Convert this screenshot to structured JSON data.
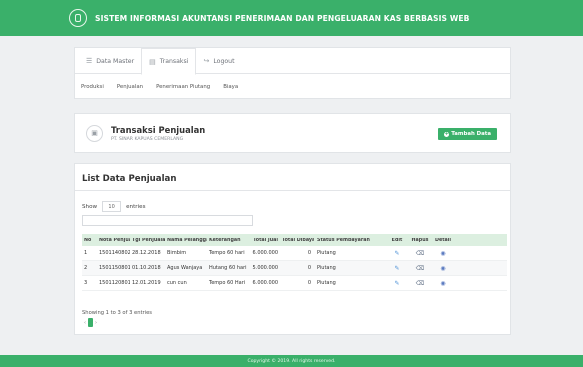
{
  "header": {
    "title": "SISTEM INFORMASI AKUNTANSI PENERIMAAN DAN PENGELUARAN KAS BERBASIS WEB"
  },
  "nav": {
    "tabs": [
      {
        "label": "Data Master",
        "icon": "users-icon"
      },
      {
        "label": "Transaksi",
        "icon": "desktop-icon"
      },
      {
        "label": "Logout",
        "icon": "logout-icon"
      }
    ],
    "subnav": [
      "Produksi",
      "Penjualan",
      "Penerimaan Piutang",
      "Biaya"
    ]
  },
  "page": {
    "title": "Transaksi Penjualan",
    "subtitle": "PT. SINAR KAPUAS CEMERLANG",
    "add_button": "Tambah Data"
  },
  "list": {
    "title": "List Data Penjualan",
    "show_label": "Show",
    "entries_value": "10",
    "entries_label": "entries",
    "search_value": "",
    "columns": [
      "No",
      "Nota Penjualan",
      "Tgl Penjualan",
      "Nama Pelanggan",
      "Keterangan",
      "Total Jual",
      "Total Dibayar",
      "Status Pembayaran",
      "Edit",
      "Hapus",
      "Detail"
    ],
    "rows": [
      [
        "1",
        "1501140802",
        "28.12.2018",
        "Bimbim",
        "Tempo 60 hari",
        "6.000.000",
        "0",
        "Piutang"
      ],
      [
        "2",
        "1501150801",
        "01.10.2018",
        "Agus Wanjaya",
        "Hutang 60 hari",
        "5.000.000",
        "0",
        "Piutang"
      ],
      [
        "3",
        "1501120801",
        "12.01.2019",
        "cun cun",
        "Tempo 60 Hari",
        "6.000.000",
        "0",
        "Piutang"
      ]
    ],
    "info": "Showing 1 to 3 of 3 entries",
    "page_number": "1"
  },
  "footer": {
    "text": "Copyright © 2019. All rights reserved."
  },
  "colors": {
    "brand": "#3ab06a",
    "table_header": "#dcefe0"
  }
}
